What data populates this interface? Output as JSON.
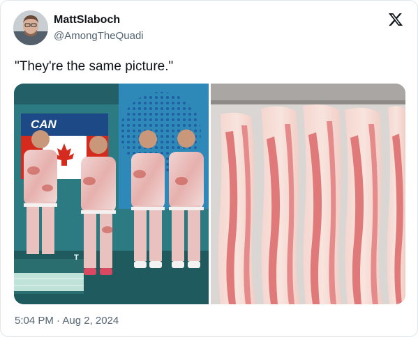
{
  "author": {
    "display_name": "MattSlaboch",
    "handle": "@AmongTheQuadi",
    "avatar_icon": "profile-photo"
  },
  "brand_icon": "x-logo-icon",
  "tweet": {
    "text": "\"They're the same picture.\"",
    "timestamp": "5:04 PM · Aug 2, 2024"
  },
  "media": {
    "left_image": {
      "scoreboard_text": "CAN",
      "bottom_mark": "T"
    },
    "right_image": {
      "subject": "bacon"
    }
  },
  "colors": {
    "text_primary": "#0f1419",
    "text_secondary": "#536471",
    "border": "#e1e6ea",
    "studio_teal": "#2f7d84",
    "canada_red": "#d52b1e",
    "bacon_pink": "#e8989a"
  }
}
